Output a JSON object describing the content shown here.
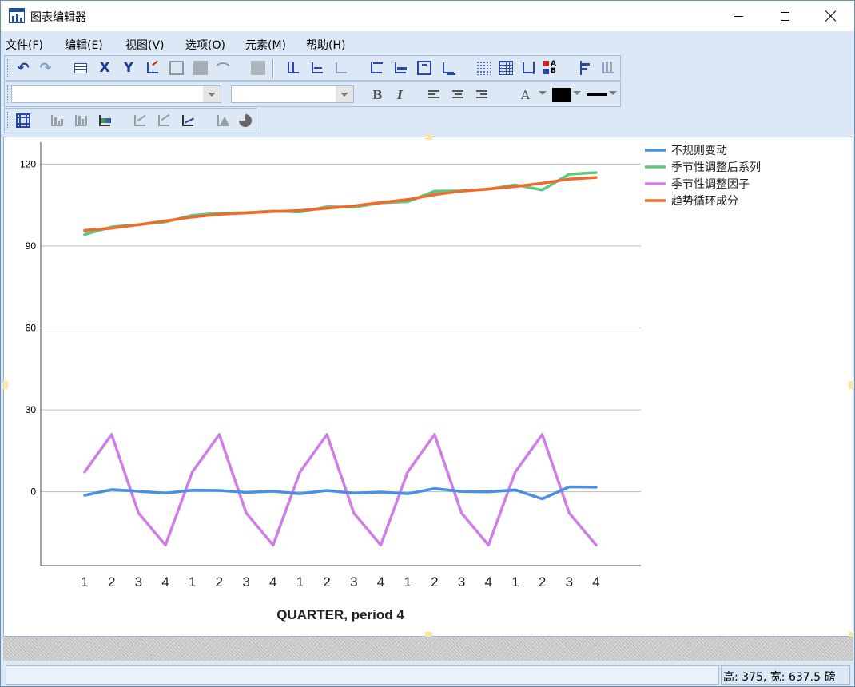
{
  "window": {
    "title": "图表编辑器"
  },
  "menu": [
    "文件(F)",
    "编辑(E)",
    "视图(V)",
    "选项(O)",
    "元素(M)",
    "帮助(H)"
  ],
  "toolbar": {
    "font_name": "",
    "font_size": "",
    "bold": "B",
    "italic": "I",
    "text_color_label": "A"
  },
  "chart_data": {
    "type": "line",
    "xlabel": "QUARTER, period 4",
    "ylabel": "",
    "categories": [
      "1",
      "2",
      "3",
      "4",
      "1",
      "2",
      "3",
      "4",
      "1",
      "2",
      "3",
      "4",
      "1",
      "2",
      "3",
      "4",
      "1",
      "2",
      "3",
      "4"
    ],
    "y_ticks": [
      0,
      30,
      60,
      90,
      120
    ],
    "ylim": [
      -27,
      128
    ],
    "grid": true,
    "legend_position": "top-right",
    "series": [
      {
        "name": "不规则变动",
        "color": "#4a90e2",
        "values": [
          -1.3,
          0.8,
          0.2,
          -0.5,
          0.6,
          0.5,
          -0.2,
          0.2,
          -0.7,
          0.5,
          -0.5,
          -0.1,
          -0.7,
          1.2,
          0.1,
          0.0,
          0.7,
          -2.6,
          1.8,
          1.7
        ]
      },
      {
        "name": "季节性调整后系列",
        "color": "#5cc97e",
        "values": [
          94.2,
          97.0,
          97.8,
          98.8,
          101.2,
          102.0,
          102.2,
          102.8,
          102.4,
          104.4,
          104.2,
          105.8,
          106.2,
          110.1,
          110.2,
          110.8,
          112.4,
          110.5,
          116.3,
          116.9
        ]
      },
      {
        "name": "季节性调整因子",
        "color": "#cf7ee6",
        "values": [
          7.3,
          21.0,
          -7.8,
          -19.5,
          7.3,
          21.0,
          -7.8,
          -19.5,
          7.3,
          21.0,
          -7.8,
          -19.5,
          7.3,
          21.0,
          -7.8,
          -19.5,
          7.3,
          21.0,
          -7.8,
          -19.5
        ]
      },
      {
        "name": "趋势循环成分",
        "color": "#f06a2c",
        "values": [
          95.7,
          96.5,
          97.8,
          99.2,
          100.6,
          101.6,
          102.1,
          102.6,
          103.0,
          103.8,
          104.7,
          105.9,
          107.0,
          108.8,
          110.1,
          110.9,
          111.8,
          113.0,
          114.5,
          115.1
        ]
      }
    ]
  },
  "status": {
    "left": "",
    "right": "高: 375, 宽: 637.5 磅"
  }
}
